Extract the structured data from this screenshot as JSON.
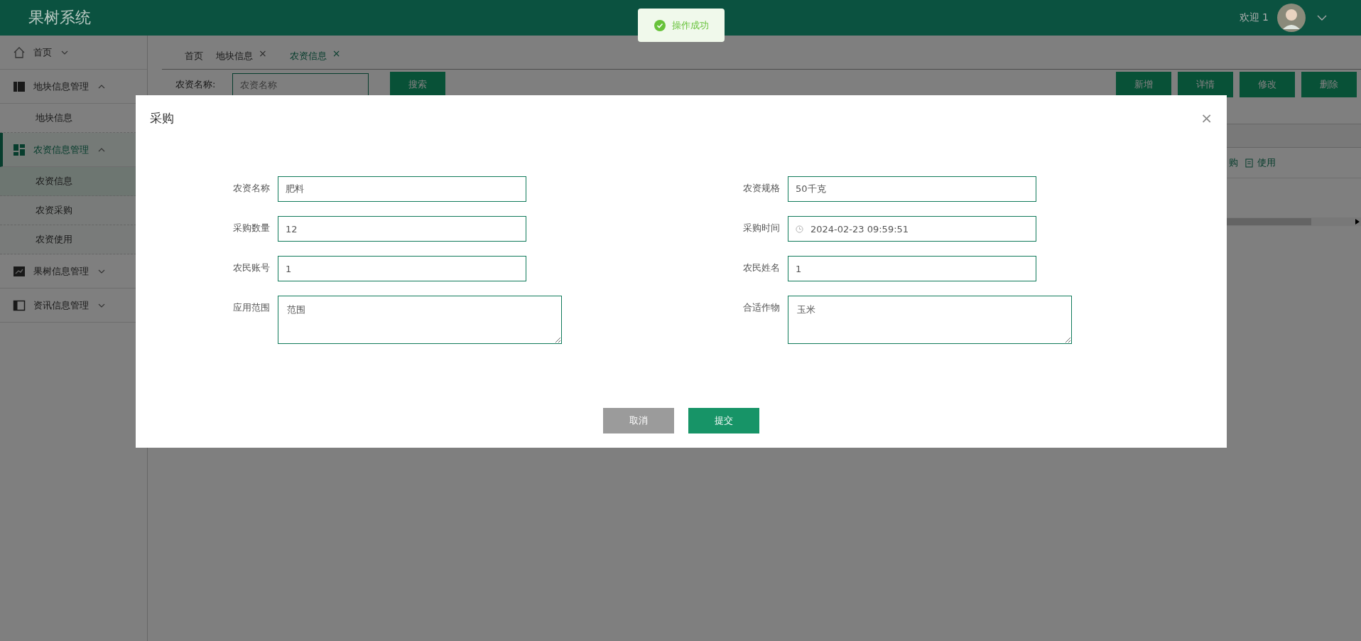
{
  "header": {
    "title": "果树系统",
    "welcome": "欢迎 1"
  },
  "toast": {
    "kind": "success",
    "text": "操作成功"
  },
  "sidebar": [
    {
      "label": "首页",
      "expanded": false,
      "selected": false
    },
    {
      "label": "地块信息管理",
      "expanded": true,
      "selected": false,
      "children": [
        {
          "label": "地块信息",
          "selected": false
        }
      ]
    },
    {
      "label": "农资信息管理",
      "expanded": true,
      "selected": true,
      "children": [
        {
          "label": "农资信息",
          "selected": true
        },
        {
          "label": "农资采购",
          "selected": false
        },
        {
          "label": "农资使用",
          "selected": false
        }
      ]
    },
    {
      "label": "果树信息管理",
      "expanded": false,
      "selected": false
    },
    {
      "label": "资讯信息管理",
      "expanded": false,
      "selected": false
    }
  ],
  "tabs": [
    {
      "label": "首页",
      "selected": false,
      "closable": false
    },
    {
      "label": "地块信息",
      "selected": false,
      "closable": true
    },
    {
      "label": "农资信息",
      "selected": true,
      "closable": true
    }
  ],
  "tab_close": "×",
  "search": {
    "label": "农资名称:",
    "placeholder": "农资名称",
    "button": "搜索"
  },
  "toolbar_buttons": [
    "新增",
    "详情",
    "修改",
    "删除"
  ],
  "row_actions": [
    "购",
    "使用"
  ],
  "dialog": {
    "title": "采购",
    "close": "×",
    "fields": [
      {
        "label": "农资名称",
        "value": "肥料",
        "kind": "text"
      },
      {
        "label": "农资规格",
        "value": "50千克",
        "kind": "text"
      },
      {
        "label": "采购数量",
        "value": "12",
        "kind": "text"
      },
      {
        "label": "采购时间",
        "value": "2024-02-23 09:59:51",
        "kind": "datetime"
      },
      {
        "label": "农民账号",
        "value": "1",
        "kind": "text"
      },
      {
        "label": "农民姓名",
        "value": "1",
        "kind": "text"
      },
      {
        "label": "应用范围",
        "value": "范围",
        "kind": "textarea"
      },
      {
        "label": "合适作物",
        "value": "玉米",
        "kind": "textarea"
      }
    ],
    "buttons": [
      {
        "label": "取消",
        "kind": "cancel"
      },
      {
        "label": "提交",
        "kind": "primary"
      }
    ]
  }
}
